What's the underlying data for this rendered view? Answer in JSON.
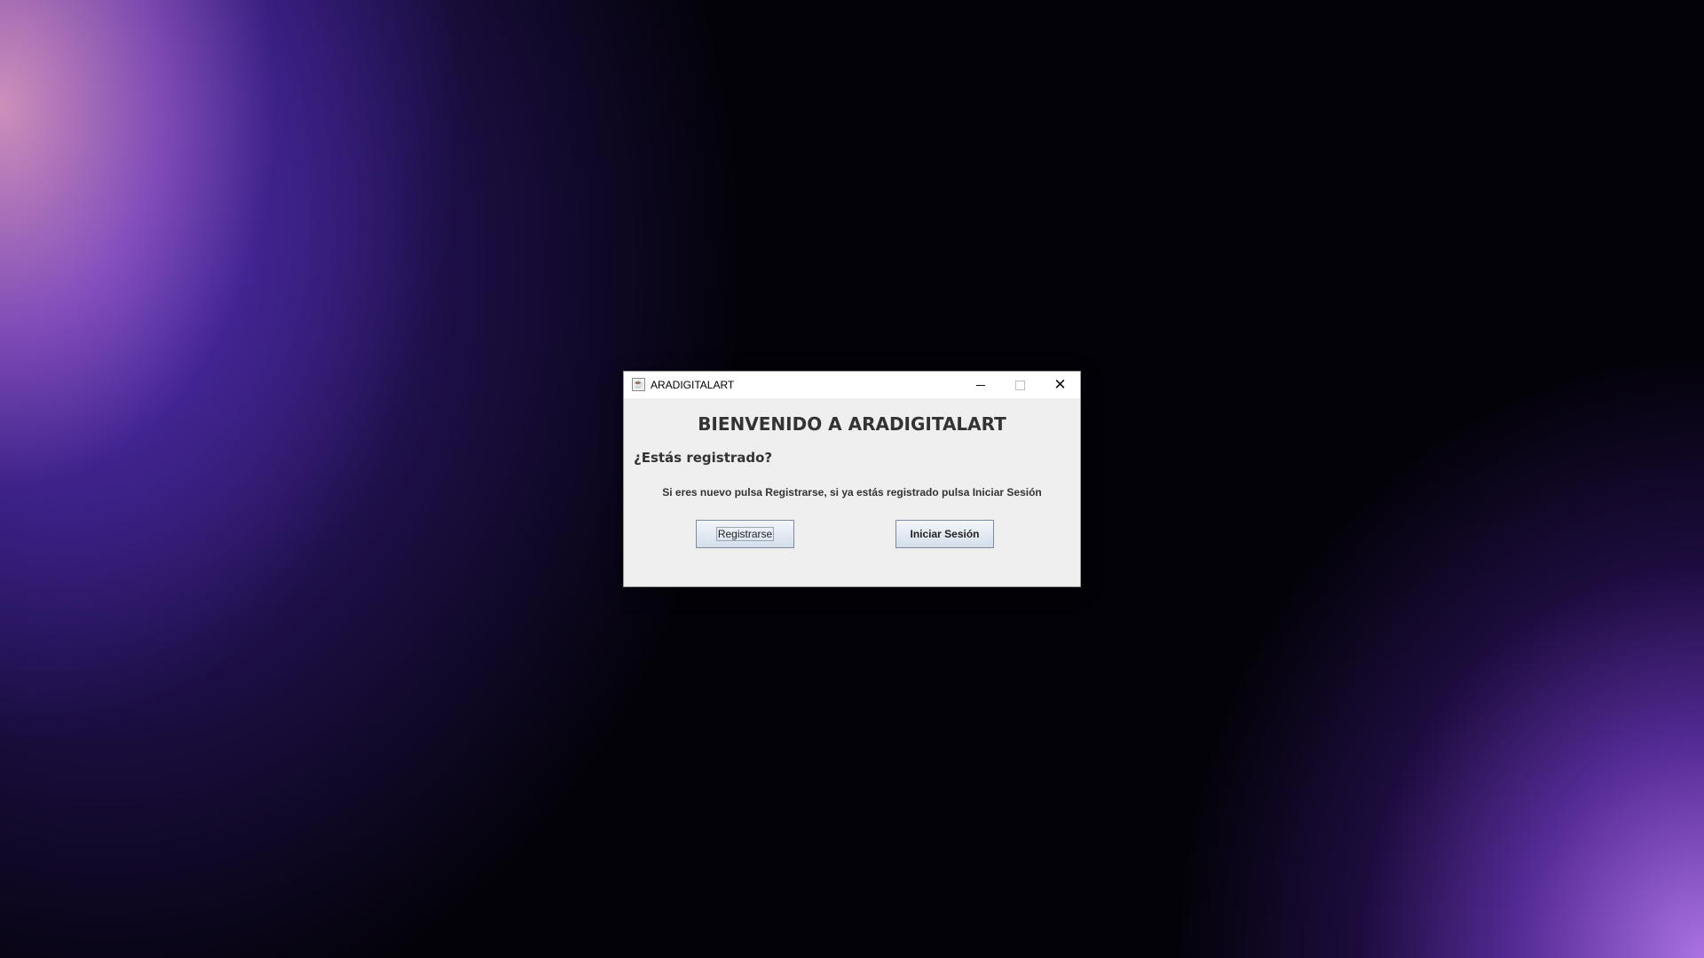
{
  "window": {
    "title": "ARADIGITALART",
    "app_icon": "java-cup-icon",
    "controls": {
      "minimize": "minimize-icon",
      "maximize": "maximize-icon",
      "close_glyph": "✕"
    }
  },
  "content": {
    "heading": "BIENVENIDO A ARADIGITALART",
    "question": "¿Estás registrado?",
    "instruction": "Si eres nuevo pulsa Registrarse, si ya estás registrado pulsa Iniciar Sesión",
    "register_label": "Registrarse",
    "login_label": "Iniciar Sesión"
  },
  "colors": {
    "window_bg": "#efefef",
    "titlebar_bg": "#ffffff",
    "text": "#333333",
    "button_border": "#7a8aa0"
  }
}
